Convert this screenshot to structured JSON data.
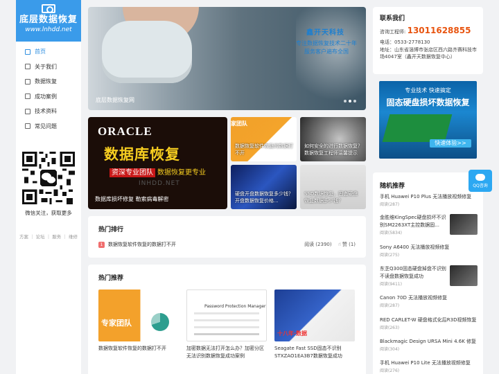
{
  "logo": {
    "title": "底层数据恢复",
    "url": "www.lnhdd.net"
  },
  "nav": [
    {
      "label": "首页",
      "active": true
    },
    {
      "label": "关于我们"
    },
    {
      "label": "数据恢复"
    },
    {
      "label": "成功案例"
    },
    {
      "label": "技术资料"
    },
    {
      "label": "常见问题"
    }
  ],
  "qr_caption": "微信关注，获取更多",
  "footer_links": "方案 ｜ 论坛 ｜ 服务 ｜ 维修",
  "banner": {
    "brand": "鑫开天科技",
    "slogan_1": "专注数据恢复技术二十年",
    "slogan_2": "服务客户遍布全国",
    "caption": "底层数据恢复网"
  },
  "featured": {
    "logo_text": "ORACLE",
    "headline": "数据库恢复",
    "tag_red": "资深专业团队",
    "tag_yellow": "数据恢复更专业",
    "site": "INHDD.NET",
    "caption": "数据库损坏修复 勒索病毒解密"
  },
  "tiles": [
    {
      "caption": "数据恢复软件恢复的数据打不开",
      "inner": "家团队"
    },
    {
      "caption": "如何安全的进行数据恢复？数据恢复工程师温馨提示"
    },
    {
      "caption": "硬盘开盘数据恢复多少钱？开盘数据恢复价格..."
    },
    {
      "caption": "SSD数据恢复，固态硬盘恢复数据多少钱？"
    }
  ],
  "hot": {
    "title": "热门排行",
    "items": [
      {
        "rank": "1",
        "title": "数据恢复软件恢复的数据打不开",
        "views": "阅读 (2390)",
        "likes": "赞 (1)"
      }
    ]
  },
  "recommend": {
    "title": "热门推荐",
    "cards": [
      {
        "title": "数据恢复软件恢复的数据打不开",
        "inner": "专家团队"
      },
      {
        "title": "加密数据无法打开怎么办？加密分区无法识别数据恢复成功案例",
        "inner": "Password Protection Manager"
      },
      {
        "title": "Seagate Fast SSD固态不识别STXZAO1EA3B7数据恢复成功",
        "inner": "十八年·数据"
      }
    ]
  },
  "contact": {
    "title": "联系我们",
    "engineer_label": "咨询工程师:",
    "engineer_phone": "13011628855",
    "tel": "电话：0533-2778130",
    "address": "地址：山东省淄博市张店区西六路齐赛科技市场4047室（鑫开天数据恢复中心）"
  },
  "ad": {
    "line1": "专业技术 快速搞定",
    "line2": "固态硬盘损坏数据恢复",
    "button": "快速体验>>"
  },
  "random": {
    "title": "随机推荐",
    "items": [
      {
        "title": "手机 Huawei P10 Plus 无法播放视频修复",
        "views": "阅读(287)"
      },
      {
        "title": "金胜维KingSpec硬盘损坏不识别SM2263XT主控数据固...",
        "views": "阅读(5834)",
        "thumb": true
      },
      {
        "title": "Sony A6400 无法播放视频修复",
        "views": "阅读(275)"
      },
      {
        "title": "东芝Q300固态硬盘掉盘不识别不读盘数据恢复成功",
        "views": "阅读(9411)",
        "thumb": true
      },
      {
        "title": "Canon 70D 无法播放视频修复",
        "views": "阅读(287)"
      },
      {
        "title": "RED CARLET-W 硬盘格式化后R3D视频恢复",
        "views": "阅读(263)"
      },
      {
        "title": "Blackmagic Design URSA Mini 4.6K 修复",
        "views": "阅读(304)"
      },
      {
        "title": "手机 Huawei P10 Lite 无法播放视频修复",
        "views": "阅读(276)"
      }
    ]
  },
  "qq": "QQ咨询",
  "colors": {
    "accent": "#3a9bea",
    "phone": "#e8540f",
    "rank": "#f06e6e",
    "qq": "#2ca8f2"
  }
}
